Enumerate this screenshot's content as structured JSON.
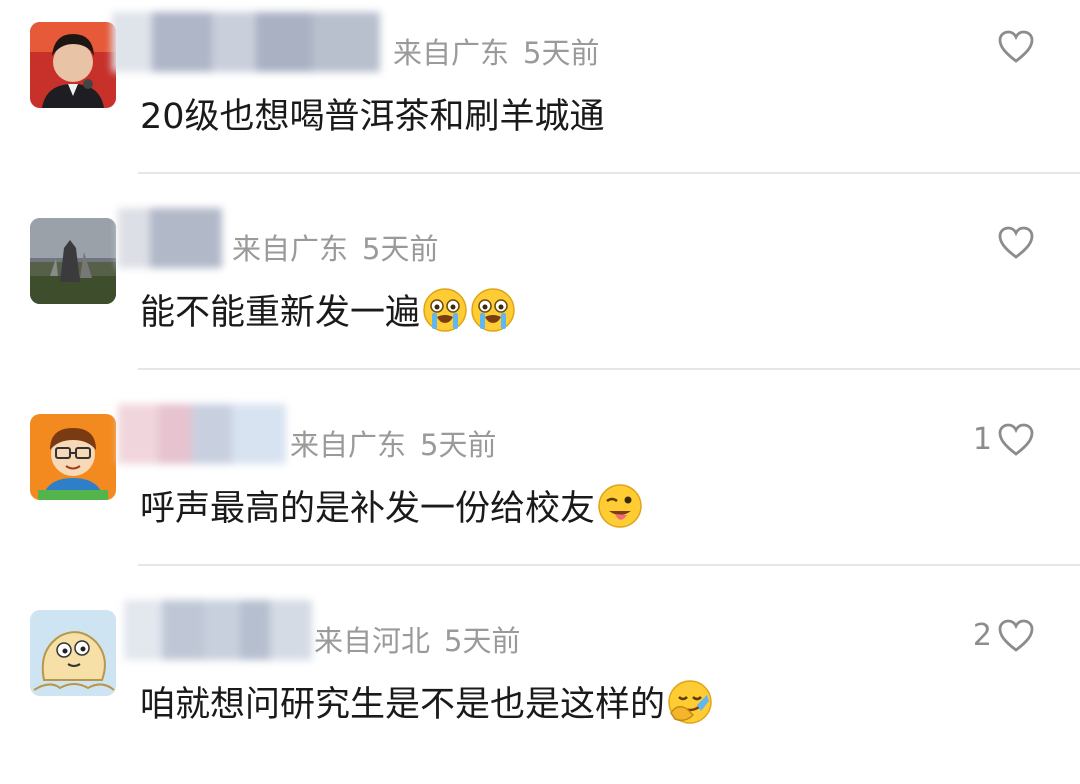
{
  "comments": [
    {
      "location": "来自广东",
      "time": "5天前",
      "text": "20级也想喝普洱茶和刷羊城通",
      "likes": "",
      "avatar": "photo-man-avatar",
      "emojis": []
    },
    {
      "location": "来自广东",
      "time": "5天前",
      "text": "能不能重新发一遍",
      "likes": "",
      "avatar": "photo-landscape-avatar",
      "emojis": [
        "crying-emoji",
        "crying-emoji"
      ]
    },
    {
      "location": "来自广东",
      "time": "5天前",
      "text": "呼声最高的是补发一份给校友",
      "likes": "1",
      "avatar": "cartoon-boy-avatar",
      "emojis": [
        "wink-tongue-emoji"
      ]
    },
    {
      "location": "来自河北",
      "time": "5天前",
      "text": "咱就想问研究生是不是也是这样的",
      "likes": "2",
      "avatar": "cartoon-doodle-avatar",
      "emojis": [
        "facepalm-emoji"
      ]
    }
  ],
  "colors": {
    "meta": "#9a9a9a",
    "text": "#1a1a1a",
    "divider": "#e6e6e6",
    "heart": "#8c8c8c"
  }
}
